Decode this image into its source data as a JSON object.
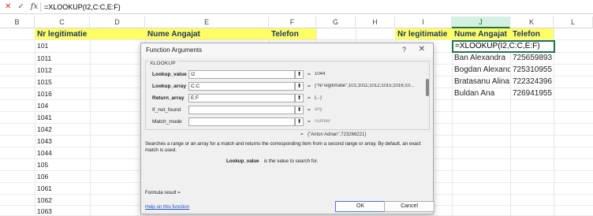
{
  "formula_bar": {
    "cancel_icon": "x-icon",
    "enter_icon": "check-icon",
    "fx_label": "fx",
    "formula": "=XLOOKUP(I2,C:C,E:F)"
  },
  "columns": [
    "B",
    "C",
    "D",
    "E",
    "F",
    "G",
    "H",
    "I",
    "J",
    "K",
    "L"
  ],
  "selected_column": "J",
  "header_row": {
    "c": "Nr legitimatie",
    "e": "Nume Angajat",
    "f": "Telefon",
    "i": "Nr legitimatie",
    "j": "Nume Angajat",
    "k": "Telefon"
  },
  "column_c_values": [
    "101",
    "1011",
    "1012",
    "1015",
    "1016",
    "104",
    "1041",
    "1042",
    "1043",
    "1044",
    "105",
    "106",
    "1061",
    "1062",
    "1063"
  ],
  "active_cell_formula": "=XLOOKUP(I2,C:C,E:F)",
  "results": [
    {
      "name": "Ban  Alexandra",
      "phone": "725659893"
    },
    {
      "name": "Bogdan Alexandru",
      "phone": "725310955"
    },
    {
      "name": "Bratasanu Alina",
      "phone": "722324396"
    },
    {
      "name": "Buldan Ana",
      "phone": "726941955"
    }
  ],
  "dialog": {
    "title": "Function Arguments",
    "help_glyph": "?",
    "close_glyph": "✕",
    "function_name": "XLOOKUP",
    "args": [
      {
        "label": "Lookup_value",
        "bold": true,
        "value": "I2",
        "result": "1044",
        "gray": false
      },
      {
        "label": "Lookup_array",
        "bold": true,
        "value": "C:C",
        "result": "{\"Nr legitimatie\";101;1011;1012;1015;1016;10...",
        "gray": false
      },
      {
        "label": "Return_array",
        "bold": true,
        "value": "E:F",
        "result": "{...}",
        "gray": false
      },
      {
        "label": "If_not_found",
        "bold": false,
        "value": "",
        "result": "any",
        "gray": true
      },
      {
        "label": "Match_mode",
        "bold": false,
        "value": "",
        "result": "number",
        "gray": true
      }
    ],
    "overall_result": "{\"Anton Adrian\",723266221}",
    "description": "Searches a range or an array for a match and returns the corresponding item from a second range or array. By default, an exact match is used.",
    "arg_description_name": "Lookup_value",
    "arg_description_text": "is the value to search for.",
    "formula_result_label": "Formula result =",
    "help_link": "Help on this function",
    "ok_label": "OK",
    "cancel_label": "Cancel"
  }
}
